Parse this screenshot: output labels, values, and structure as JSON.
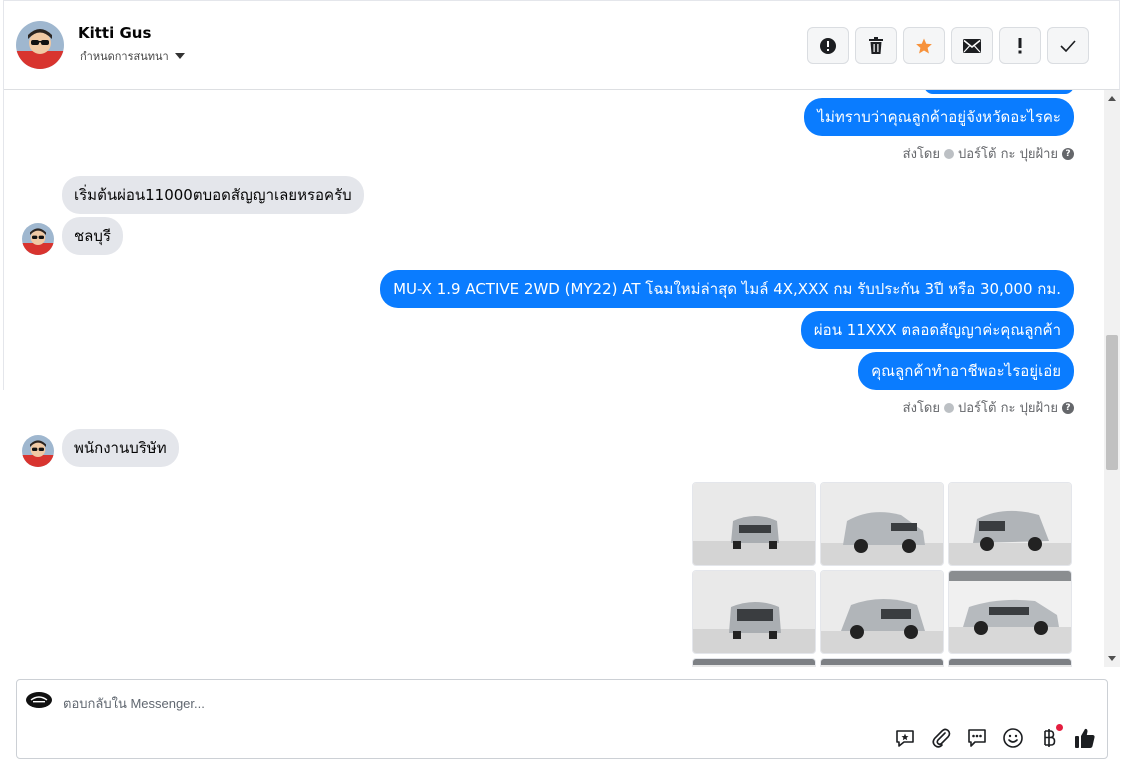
{
  "header": {
    "contact_name": "Kitti Gus",
    "assign_label": "กำหนดการสนทนา",
    "actions": [
      {
        "name": "report-button",
        "icon": "alert-circle-icon"
      },
      {
        "name": "delete-button",
        "icon": "trash-icon"
      },
      {
        "name": "star-button",
        "icon": "star-icon",
        "color": "#f7923b"
      },
      {
        "name": "mail-button",
        "icon": "envelope-icon"
      },
      {
        "name": "important-button",
        "icon": "exclamation-icon"
      },
      {
        "name": "done-button",
        "icon": "check-icon"
      }
    ]
  },
  "thread": {
    "messages": [
      {
        "side": "out",
        "text": "ไม่ทราบว่าคุณลูกค้าอยู่จังหวัดอะไรคะ"
      },
      {
        "side": "in",
        "text": "เริ่มต้นผ่อน11000ตบอดสัญญาเลยหรอครับ"
      },
      {
        "side": "in",
        "text": "ชลบุรี"
      },
      {
        "side": "out",
        "text": "MU-X 1.9 ACTIVE 2WD (MY22) AT โฉมใหม่ล่าสุด ไมล์ 4X,XXX กม รับประกัน 3ปี หรือ 30,000 กม."
      },
      {
        "side": "out",
        "text": "ผ่อน 11XXX ตลอดสัญญาค่ะคุณลูกค้า"
      },
      {
        "side": "out",
        "text": "คุณลูกค้าทำอาชีพอะไรอยู่เอ่ย"
      },
      {
        "side": "in",
        "text": "พนักงานบริษัท"
      }
    ],
    "sent_by": "ส่งโดย",
    "sender_name": "ปอร์โต้ กะ ปุยฝ้าย",
    "sent_by_2": "ส่งโดย",
    "sender_name_2": "ปอร์โต้ กะ ปุยฝ้าย"
  },
  "composer": {
    "placeholder": "ตอบกลับใน Messenger...",
    "tools": [
      "sticker-reply-icon",
      "paperclip-icon",
      "chat-bubble-icon",
      "smiley-icon",
      "baht-icon",
      "thumbs-up-icon"
    ],
    "accent": "#0a7cff"
  }
}
